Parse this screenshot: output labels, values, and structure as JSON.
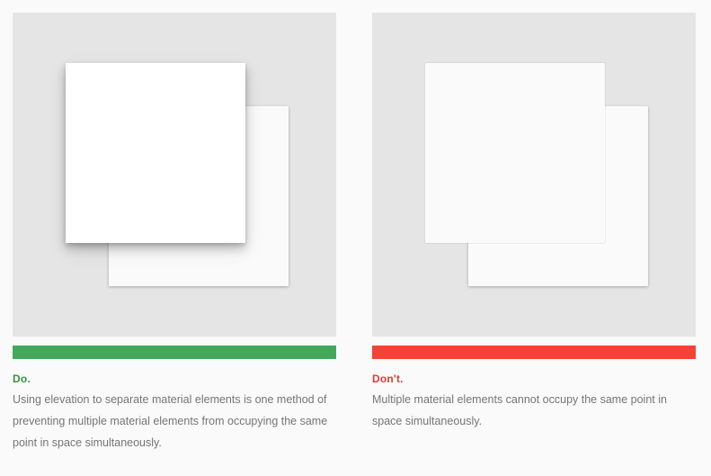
{
  "do_panel": {
    "verdict": "Do.",
    "description": "Using elevation to separate material elements is one method of preventing multiple material elements from occupying the same point in space simultaneously.",
    "bar_color": "#43a85a"
  },
  "dont_panel": {
    "verdict": "Don't.",
    "description": "Multiple material elements cannot occupy the same point in space simultaneously.",
    "bar_color": "#f44336"
  },
  "colors": {
    "canvas_background": "#e5e5e5",
    "page_background": "#fafafa",
    "do_text": "#3a8f3f",
    "dont_text": "#e53935"
  }
}
